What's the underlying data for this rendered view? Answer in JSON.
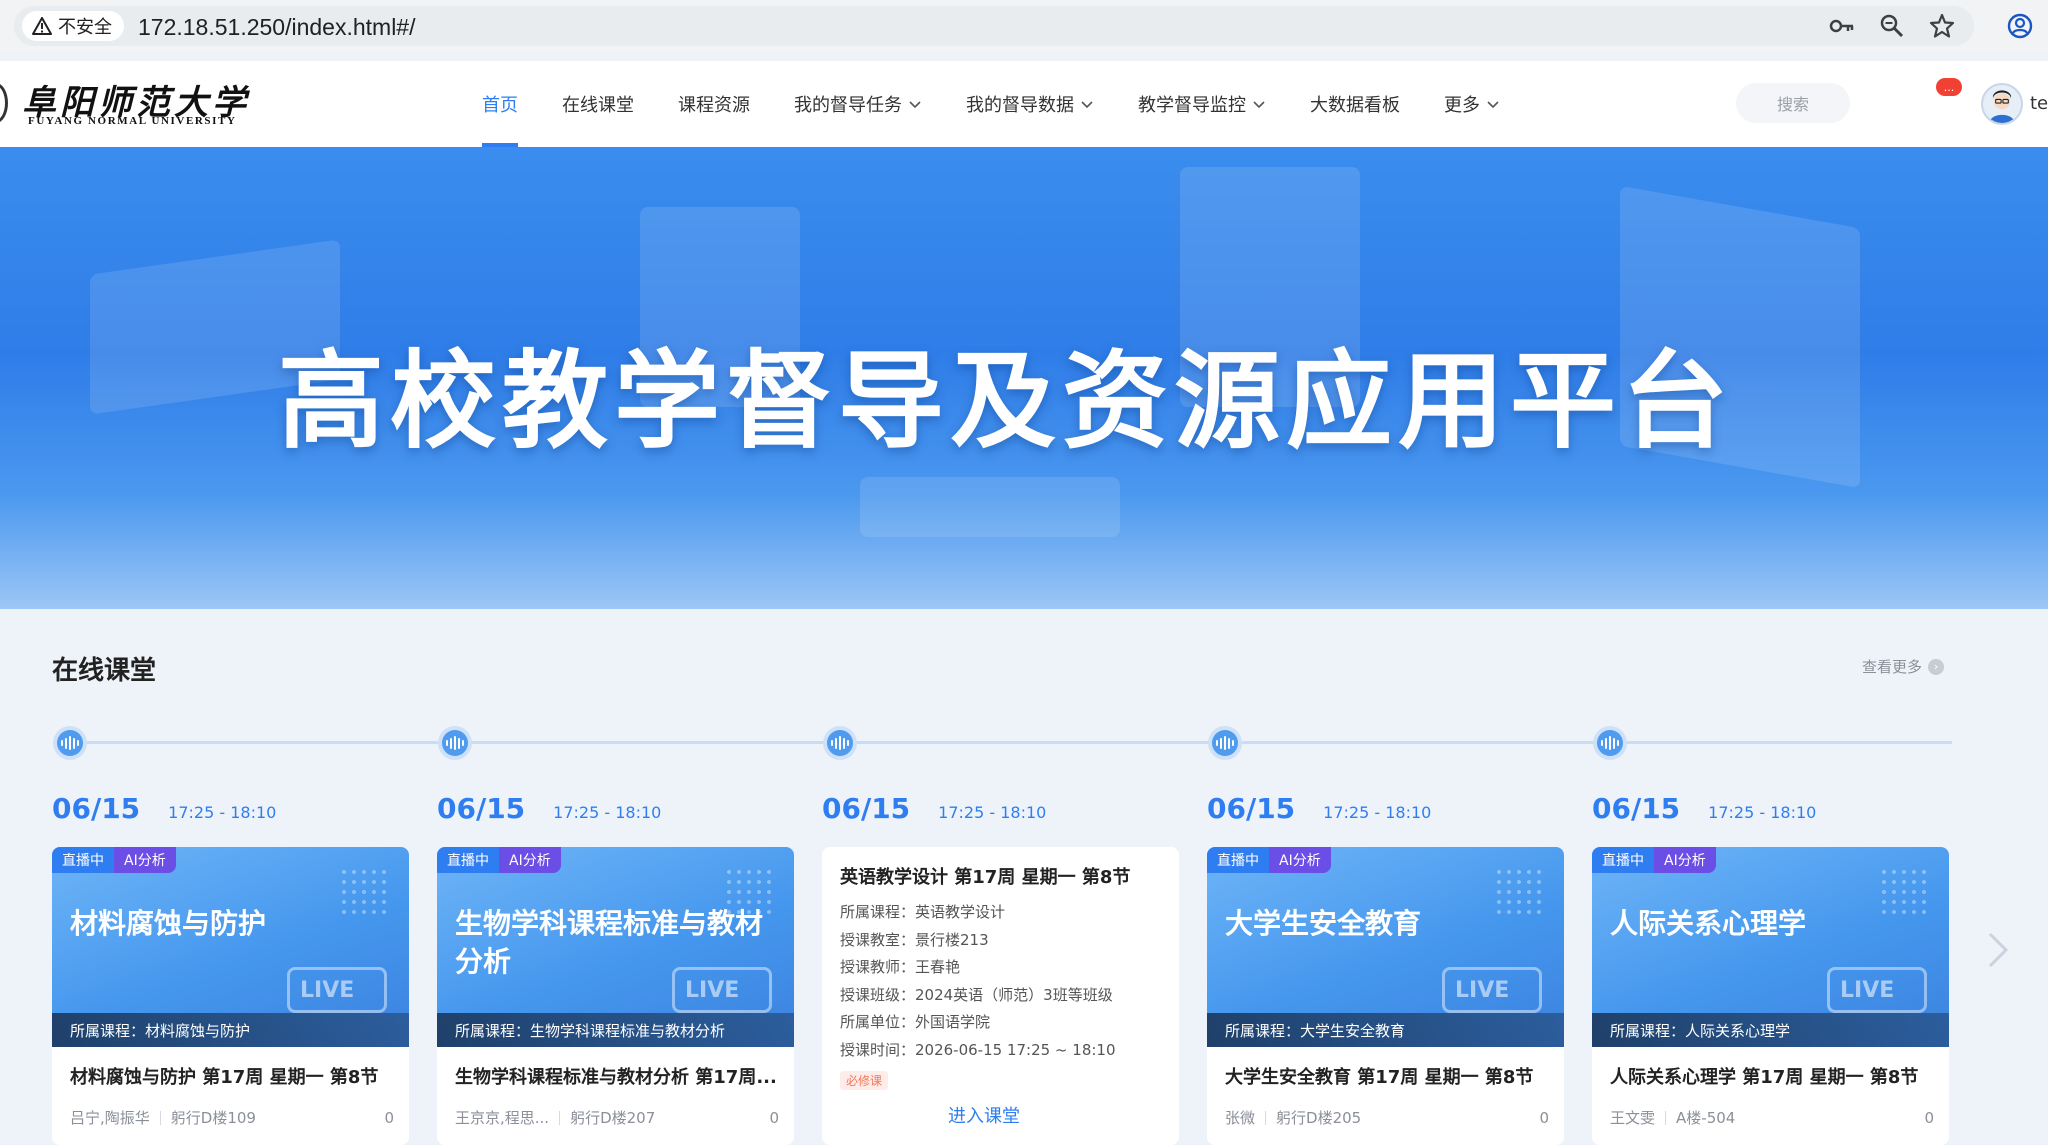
{
  "browser": {
    "security_label": "不安全",
    "url": "172.18.51.250/index.html#/"
  },
  "logo": {
    "name_cn": "阜阳师范大学",
    "name_en": "FUYANG NORMAL UNIVERSITY"
  },
  "nav": {
    "items": [
      {
        "label": "首页",
        "active": true,
        "dropdown": false
      },
      {
        "label": "在线课堂",
        "active": false,
        "dropdown": false
      },
      {
        "label": "课程资源",
        "active": false,
        "dropdown": false
      },
      {
        "label": "我的督导任务",
        "active": false,
        "dropdown": true
      },
      {
        "label": "我的督导数据",
        "active": false,
        "dropdown": true
      },
      {
        "label": "教学督导监控",
        "active": false,
        "dropdown": true
      },
      {
        "label": "大数据看板",
        "active": false,
        "dropdown": false
      },
      {
        "label": "更多",
        "active": false,
        "dropdown": true
      }
    ],
    "search_placeholder": "搜索",
    "notification_badge": "...",
    "user_name_fragment": "te"
  },
  "banner": {
    "title": "高校教学督导及资源应用平台"
  },
  "online_class": {
    "section_title": "在线课堂",
    "see_more": "查看更多",
    "cards": [
      {
        "date": "06/15",
        "time": "17:25 - 18:10",
        "tag_live": "直播中",
        "tag_ai": "AI分析",
        "cover_title": "材料腐蚀与防护",
        "cover_footer": "所属课程：材料腐蚀与防护",
        "name": "材料腐蚀与防护 第17周 星期一 第8节",
        "teacher": "吕宁,陶振华",
        "room": "躬行D楼109",
        "count": "0",
        "live_mark": "LIVE"
      },
      {
        "date": "06/15",
        "time": "17:25 - 18:10",
        "tag_live": "直播中",
        "tag_ai": "AI分析",
        "cover_title": "生物学科课程标准与教材分析",
        "cover_footer": "所属课程：生物学科课程标准与教材分析",
        "name": "生物学科课程标准与教材分析 第17周...",
        "teacher": "王京京,程思...",
        "room": "躬行D楼207",
        "count": "0",
        "live_mark": "LIVE"
      },
      {
        "date": "06/15",
        "time": "17:25 - 18:10",
        "detail_title": "英语教学设计 第17周 星期一 第8节",
        "rows": [
          "所属课程：英语教学设计",
          "授课教室：景行楼213",
          "授课教师：王春艳",
          "授课班级：2024英语（师范）3班等班级",
          "所属单位：外国语学院",
          "授课时间：2026-06-15 17:25 ~ 18:10"
        ],
        "required_tag": "必修课",
        "enter_label": "进入课堂"
      },
      {
        "date": "06/15",
        "time": "17:25 - 18:10",
        "tag_live": "直播中",
        "tag_ai": "AI分析",
        "cover_title": "大学生安全教育",
        "cover_footer": "所属课程：大学生安全教育",
        "name": "大学生安全教育 第17周 星期一 第8节",
        "teacher": "张微",
        "room": "躬行D楼205",
        "count": "0",
        "live_mark": "LIVE"
      },
      {
        "date": "06/15",
        "time": "17:25 - 18:10",
        "tag_live": "直播中",
        "tag_ai": "AI分析",
        "cover_title": "人际关系心理学",
        "cover_footer": "所属课程：人际关系心理学",
        "name": "人际关系心理学 第17周 星期一 第8节",
        "teacher": "王文雯",
        "room": "A楼-504",
        "count": "0",
        "live_mark": "LIVE"
      }
    ]
  },
  "icons": {
    "warning": "warning-triangle-icon",
    "key": "key-icon",
    "zoom": "zoom-icon",
    "star": "star-icon",
    "account": "account-icon",
    "next": "chevron-right-icon"
  },
  "colors": {
    "accent": "#2f7ef1",
    "ai_tag": "#6a4ee6",
    "badge": "#f04134"
  }
}
